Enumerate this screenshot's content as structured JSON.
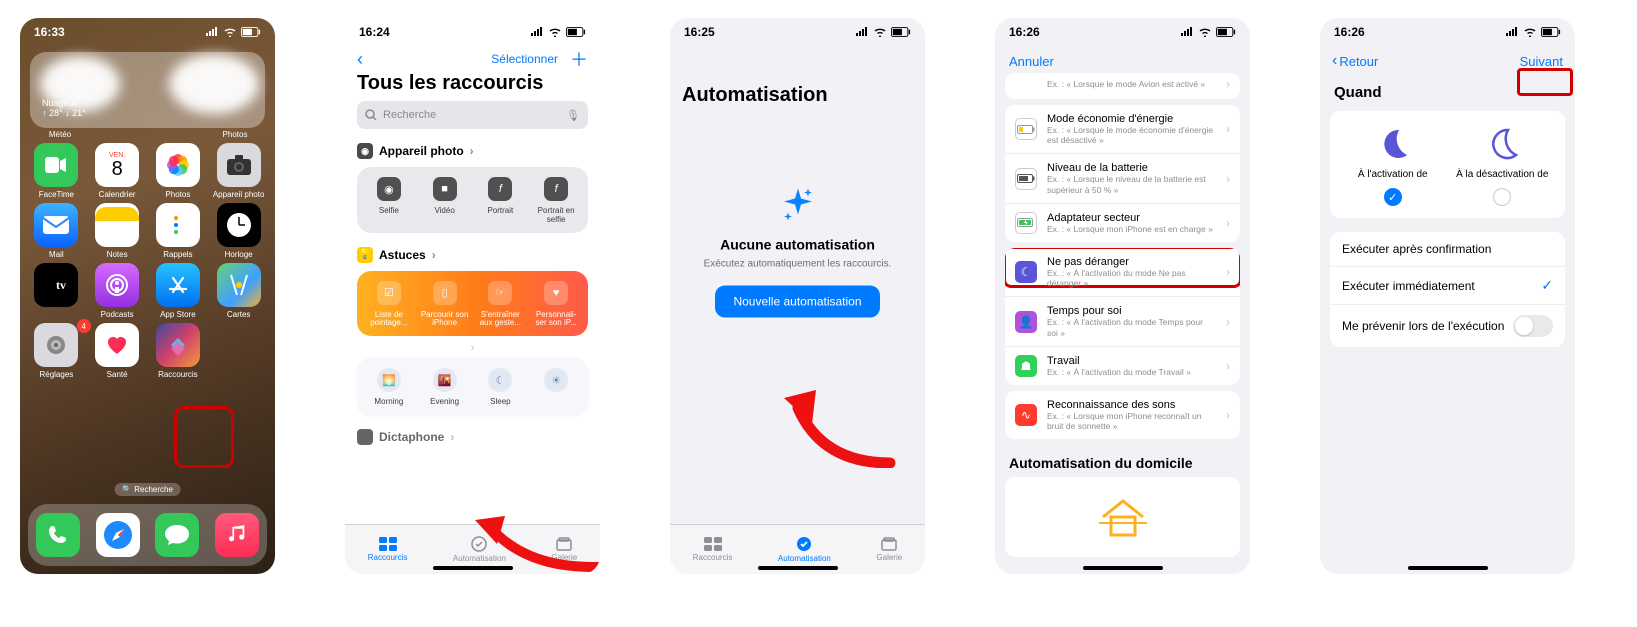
{
  "s1": {
    "time": "16:33",
    "weather_sub": "Nuageux",
    "weather_temp": "↑ 28° ↓ 21°",
    "widget_left_label": "Météo",
    "widget_right_label": "Photos",
    "apps_r1": [
      "FaceTime",
      "Calendrier",
      "Photos",
      "Appareil photo"
    ],
    "cal_day": "VEN.",
    "cal_num": "8",
    "apps_r2": [
      "Mail",
      "Notes",
      "Rappels",
      "Horloge"
    ],
    "apps_r3": [
      "Podcasts",
      "App Store",
      "Cartes"
    ],
    "tv_label": "tv",
    "apps_r4": [
      "Réglages",
      "Santé",
      "Raccourcis"
    ],
    "badge_reglages": "4",
    "search_pill": "Recherche"
  },
  "s2": {
    "time": "16:24",
    "select": "Sélectionner",
    "title": "Tous les raccourcis",
    "search_placeholder": "Recherche",
    "cam_section": "Appareil photo",
    "cam_items": [
      "Selfie",
      "Vidéo",
      "Portrait",
      "Portrait en selfie"
    ],
    "ast_section": "Astuces",
    "ast_items": [
      "Liste de pointage...",
      "Parcourir son iPhone",
      "S'entraîner aux geste...",
      "Personnali-ser son iP..."
    ],
    "time_items": [
      "Morning",
      "Evening",
      "Sleep",
      ""
    ],
    "dict_section": "Dictaphone",
    "tabs": [
      "Raccourcis",
      "Automatisation",
      "Galerie"
    ]
  },
  "s3": {
    "time": "16:25",
    "title": "Automatisation",
    "empty_title": "Aucune automatisation",
    "empty_sub": "Exécutez automatiquement les raccourcis.",
    "button": "Nouvelle automatisation",
    "tabs": [
      "Raccourcis",
      "Automatisation",
      "Galerie"
    ]
  },
  "s4": {
    "time": "16:26",
    "cancel": "Annuler",
    "row0_sub": "Ex. : « Lorsque le mode Avion est activé »",
    "rows": [
      {
        "t": "Mode économie d'énergie",
        "s": "Ex. : « Lorsque le mode économie d'énergie est désactivé »"
      },
      {
        "t": "Niveau de la batterie",
        "s": "Ex. : « Lorsque le niveau de la batterie est supérieur à 50 % »"
      },
      {
        "t": "Adaptateur secteur",
        "s": "Ex. : « Lorsque mon iPhone est en charge »"
      }
    ],
    "focus": [
      {
        "t": "Ne pas déranger",
        "s": "Ex. : « À l'activation du mode Ne pas déranger »"
      },
      {
        "t": "Temps pour soi",
        "s": "Ex. : « À l'activation du mode Temps pour soi »"
      },
      {
        "t": "Travail",
        "s": "Ex. : « À l'activation du mode Travail »"
      }
    ],
    "sound": {
      "t": "Reconnaissance des sons",
      "s": "Ex. : « Lorsque mon iPhone reconnaît un bruit de sonnette »"
    },
    "domicile": "Automatisation du domicile"
  },
  "s5": {
    "time": "16:26",
    "back": "Retour",
    "next": "Suivant",
    "when": "Quand",
    "choice_on": "À l'activation de",
    "choice_off": "À la désactivation de",
    "opt1": "Exécuter après confirmation",
    "opt2": "Exécuter immédiatement",
    "opt3": "Me prévenir lors de l'exécution"
  }
}
